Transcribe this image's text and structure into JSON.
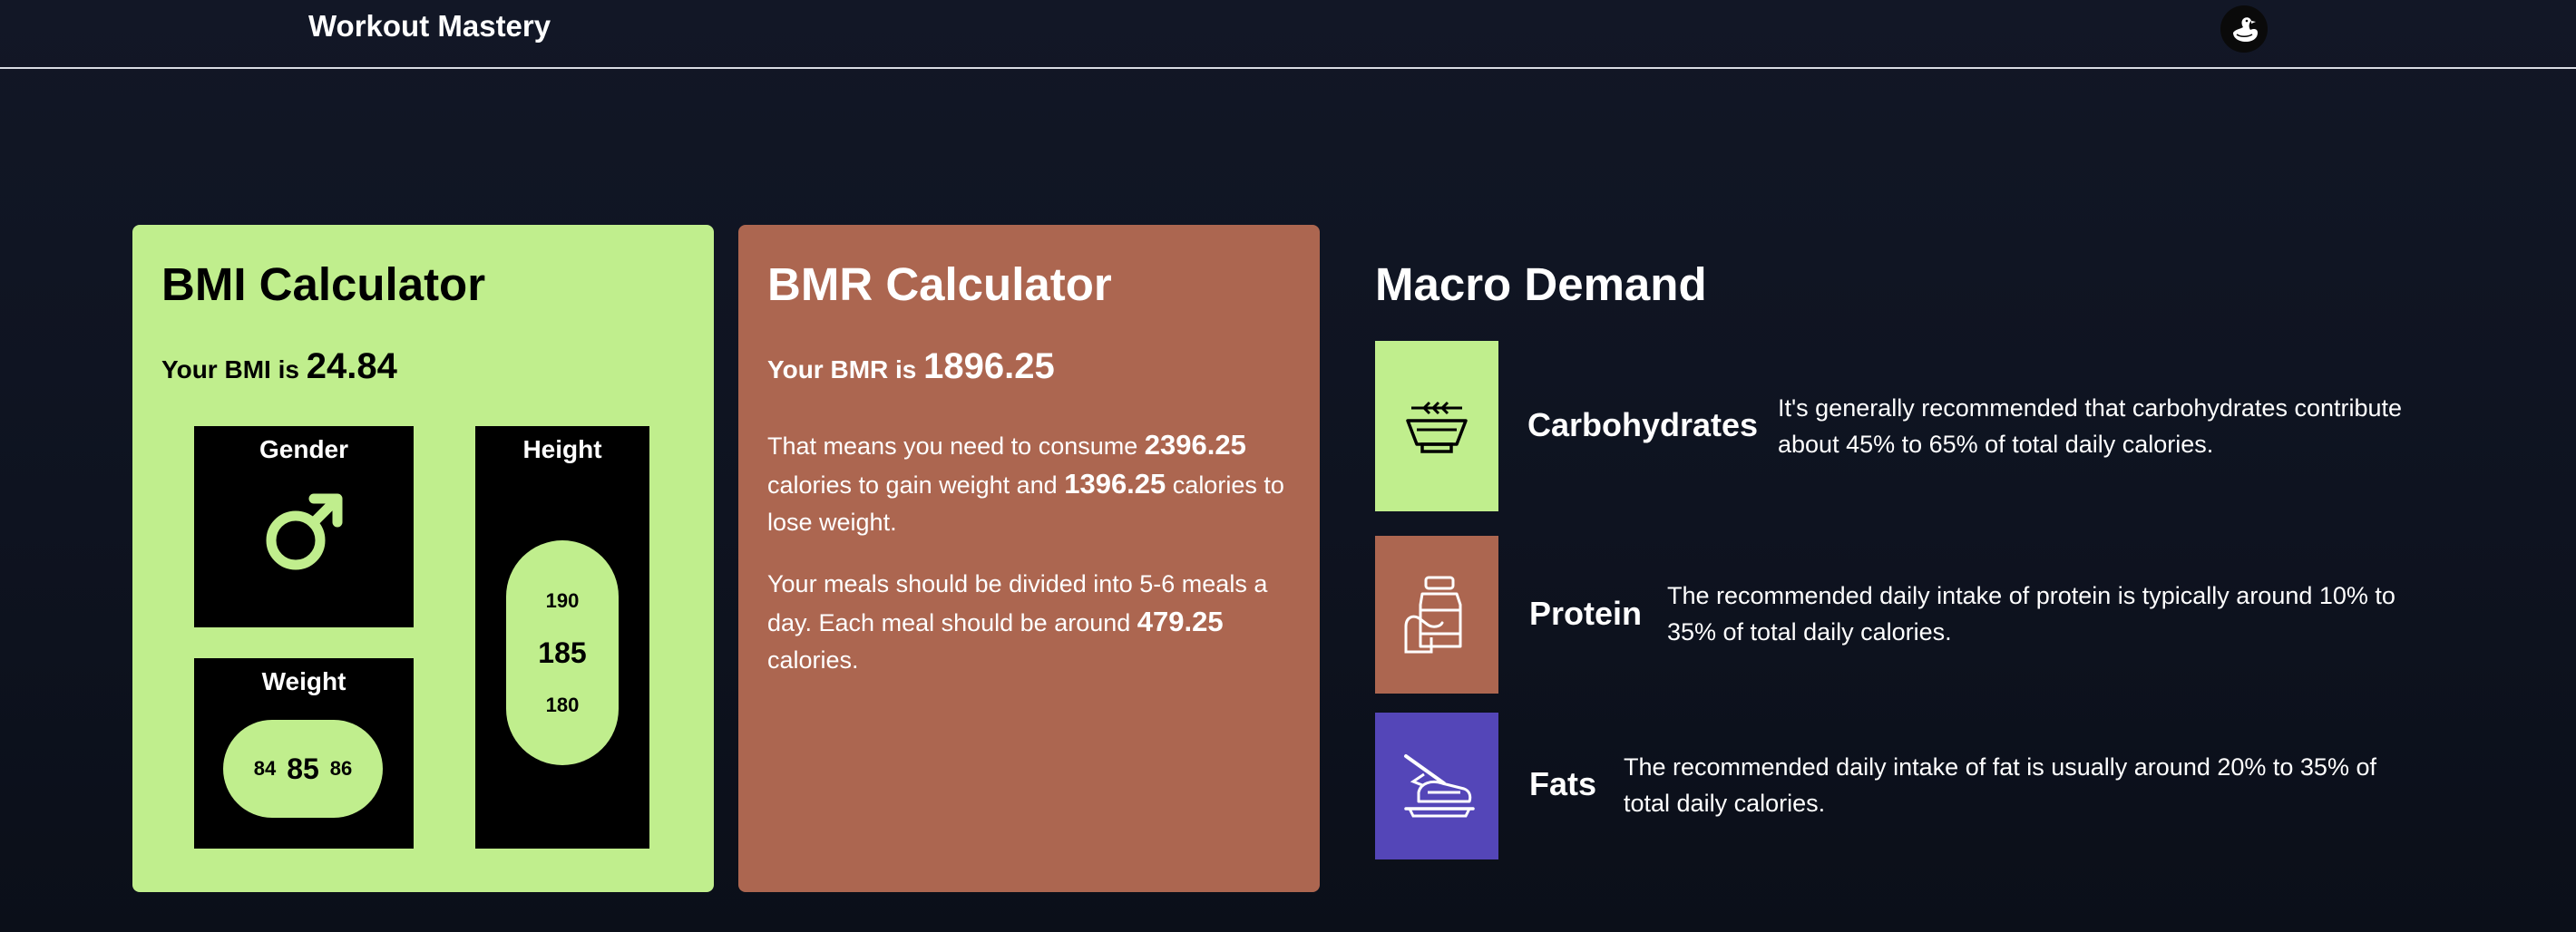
{
  "header": {
    "brand": "Workout Mastery",
    "avatar_icon": "duck-icon"
  },
  "bmi": {
    "title": "BMI Calculator",
    "result_label": "Your BMI is",
    "result_value": "24.84",
    "gender": {
      "label": "Gender",
      "icon": "male-icon"
    },
    "weight": {
      "label": "Weight",
      "prev": "84",
      "current": "85",
      "next": "86"
    },
    "height": {
      "label": "Height",
      "above": "190",
      "current": "185",
      "below": "180"
    },
    "accent": "#c0ee8d"
  },
  "bmr": {
    "title": "BMR Calculator",
    "result_label": "Your BMR is",
    "result_value": "1896.25",
    "p1_a": "That means you need to consume",
    "gain_calories": "2396.25",
    "p1_b": "calories to gain weight and",
    "lose_calories": "1396.25",
    "p1_c": "calories to lose weight.",
    "p2_a": "Your meals should be divided into 5-6 meals a day. Each meal should be around",
    "meal_calories": "479.25",
    "p2_b": "calories.",
    "color": "#ac6650"
  },
  "macro": {
    "title": "Macro Demand",
    "items": [
      {
        "name": "Carbohydrates",
        "icon": "grain-bowl-icon",
        "color": "#c0ee8d",
        "description": "It's generally recommended that carbohydrates contribute about 45% to 65% of total daily calories."
      },
      {
        "name": "Protein",
        "icon": "protein-jar-icon",
        "color": "#ac6650",
        "description": "The recommended daily intake of protein is typically around 10% to 35% of total daily calories."
      },
      {
        "name": "Fats",
        "icon": "butter-icon",
        "color": "#5446b8",
        "description": "The recommended daily intake of fat is usually around 20% to 35% of total daily calories."
      }
    ]
  }
}
